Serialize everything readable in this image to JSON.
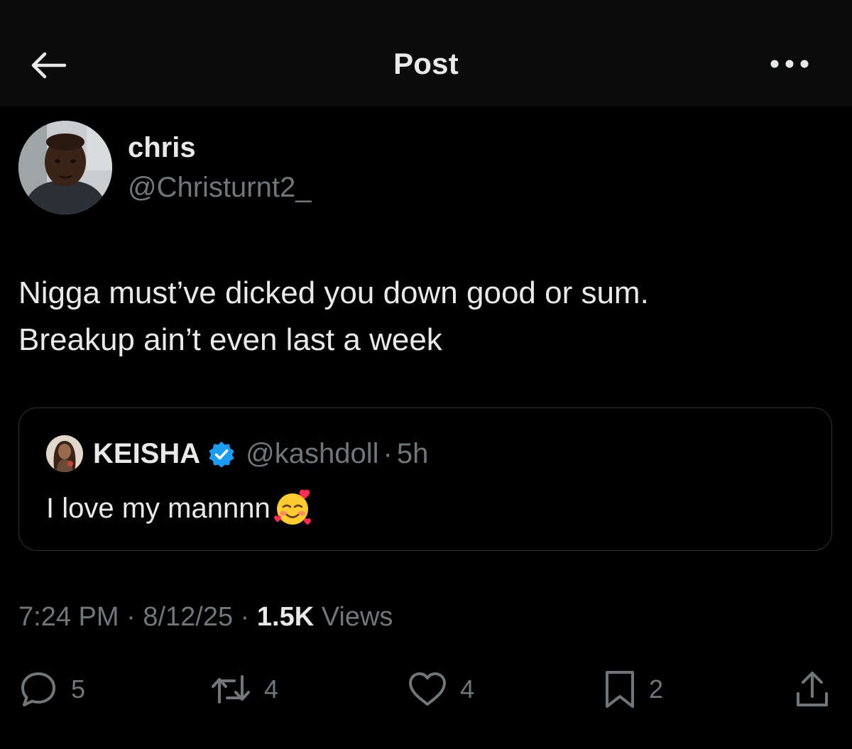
{
  "header": {
    "title": "Post",
    "back_icon": "arrow-left-icon",
    "more_icon": "more-horizontal-icon"
  },
  "post": {
    "author": {
      "display_name": "chris",
      "handle": "@Christurnt2_"
    },
    "text_lines": [
      "Nigga must’ve dicked you down good or sum.",
      "Breakup ain’t even last a week"
    ],
    "quoted": {
      "display_name": "KEISHA",
      "verified": true,
      "handle": "@kashdoll",
      "separator": "·",
      "time": "5h",
      "text": "I love my mannnn",
      "emoji_icon": "smiling-face-with-hearts-icon"
    },
    "meta": {
      "time": "7:24 PM",
      "sep1": " · ",
      "date": "8/12/25",
      "sep2": " · ",
      "views_count": "1.5K",
      "views_label": " Views"
    }
  },
  "actions": {
    "replies": "5",
    "reposts": "4",
    "likes": "4",
    "bookmarks": "2"
  },
  "colors": {
    "background": "#000000",
    "header_background": "#0b0b0b",
    "text_primary": "#e7e9ea",
    "text_secondary": "#71767b",
    "border": "#2f3336",
    "verified_blue": "#1d9bf0"
  }
}
